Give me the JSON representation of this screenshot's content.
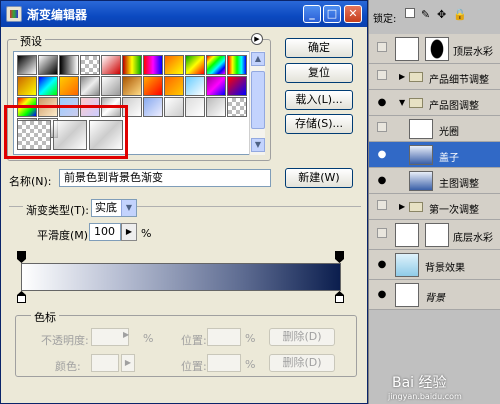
{
  "dialog": {
    "title": "渐变编辑器",
    "presets_label": "预设",
    "ok_button": "确定",
    "reset_button": "复位",
    "load_button": "载入(L)...",
    "save_button": "存储(S)...",
    "name_label": "名称(N):",
    "name_value": "前景色到背景色渐变",
    "new_button": "新建(W)",
    "gradient_type_label": "渐变类型(T):",
    "gradient_type_value": "实底",
    "smoothness_label": "平滑度(M):",
    "smoothness_value": "100",
    "percent": "%",
    "stops_label": "色标",
    "opacity_label": "不透明度:",
    "color_label": "颜色:",
    "location_label": "位置:",
    "delete_button": "删除(D)",
    "gradient_colors": [
      "#ffffff",
      "#0b1e4e"
    ]
  },
  "presets": [
    "linear-gradient(135deg,#000,#fff)",
    "linear-gradient(135deg,#fff,#000)",
    "linear-gradient(90deg,#000,#fff)",
    "checker",
    "linear-gradient(135deg,#fff,#c00)",
    "linear-gradient(90deg,#b00,#ff0,#0a0)",
    "linear-gradient(90deg,#f00,#f0f,#00f)",
    "linear-gradient(135deg,#f60,#ff0)",
    "linear-gradient(135deg,#0a0,#ff0,#f00)",
    "linear-gradient(135deg,#f00,#ff0,#0f0,#0ff,#00f,#f0f)",
    "linear-gradient(90deg,#f00,#ff0,#0f0,#0ff,#00f)",
    "linear-gradient(135deg,#c60,#ff0)",
    "linear-gradient(135deg,#00f,#0ff,#0f0)",
    "linear-gradient(135deg,#fc0,#f60)",
    "linear-gradient(135deg,#888,#eee,#888)",
    "linear-gradient(135deg,#fff,#999)",
    "linear-gradient(135deg,#a50,#fd8)",
    "linear-gradient(135deg,#fa0,#f00)",
    "linear-gradient(135deg,#f60,#fc0)",
    "linear-gradient(135deg,#6cf,#fff)",
    "linear-gradient(135deg,#909,#f0f,#00f)",
    "linear-gradient(135deg,#f00,#00f)",
    "linear-gradient(135deg,#f00,#ff0,#0f0,#00f)",
    "linear-gradient(135deg,#c96,#fec)",
    "linear-gradient(135deg,#9cf,#cce)",
    "linear-gradient(135deg,#fcc,#ccf)",
    "linear-gradient(135deg,#aaa,#fff,#aaa)",
    "linear-gradient(135deg,#ccc,#fff)",
    "linear-gradient(135deg,#8ae,#eef)",
    "linear-gradient(135deg,#fff,#ccc)",
    "linear-gradient(135deg,#ddd,#fff)",
    "linear-gradient(135deg,#bbb,#fff)",
    "checker",
    "linear-gradient(135deg,#fff,#aaa,#fff)",
    "linear-gradient(135deg,#ccc,#fff,#999)"
  ],
  "layers": {
    "toolbar_label": "锁定:",
    "rows": [
      {
        "name": "顶层水彩",
        "visible": false,
        "type": "layer-mask"
      },
      {
        "name": "产品细节调整",
        "visible": false,
        "type": "group"
      },
      {
        "name": "产品图调整",
        "visible": true,
        "type": "group-open"
      },
      {
        "name": "光圈",
        "visible": false,
        "type": "layer"
      },
      {
        "name": "盖子",
        "visible": true,
        "type": "layer-selected"
      },
      {
        "name": "主图调整",
        "visible": true,
        "type": "layer"
      },
      {
        "name": "第一次调整",
        "visible": false,
        "type": "group"
      },
      {
        "name": "底层水彩",
        "visible": false,
        "type": "layer-mask"
      },
      {
        "name": "背景效果",
        "visible": true,
        "type": "layer"
      },
      {
        "name": "背景",
        "visible": true,
        "type": "layer"
      }
    ]
  },
  "watermark": {
    "text": "Bai 经验",
    "url": "jingyan.baidu.com"
  }
}
